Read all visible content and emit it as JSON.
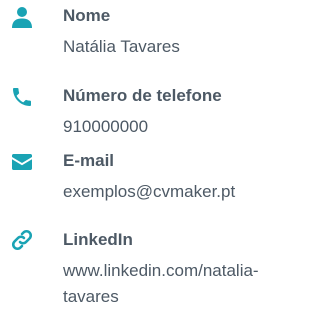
{
  "accent_color": "#1aa3b4",
  "contacts": [
    {
      "icon": "person-icon",
      "label": "Nome",
      "value": "Natália Tavares"
    },
    {
      "icon": "phone-icon",
      "label": "Número de telefone",
      "value": "910000000"
    },
    {
      "icon": "envelope-icon",
      "label": "E-mail",
      "value": "exemplos@cvmaker.pt"
    },
    {
      "icon": "link-icon",
      "label": "LinkedIn",
      "value": "www.linkedin.com/natalia-tavares"
    }
  ]
}
